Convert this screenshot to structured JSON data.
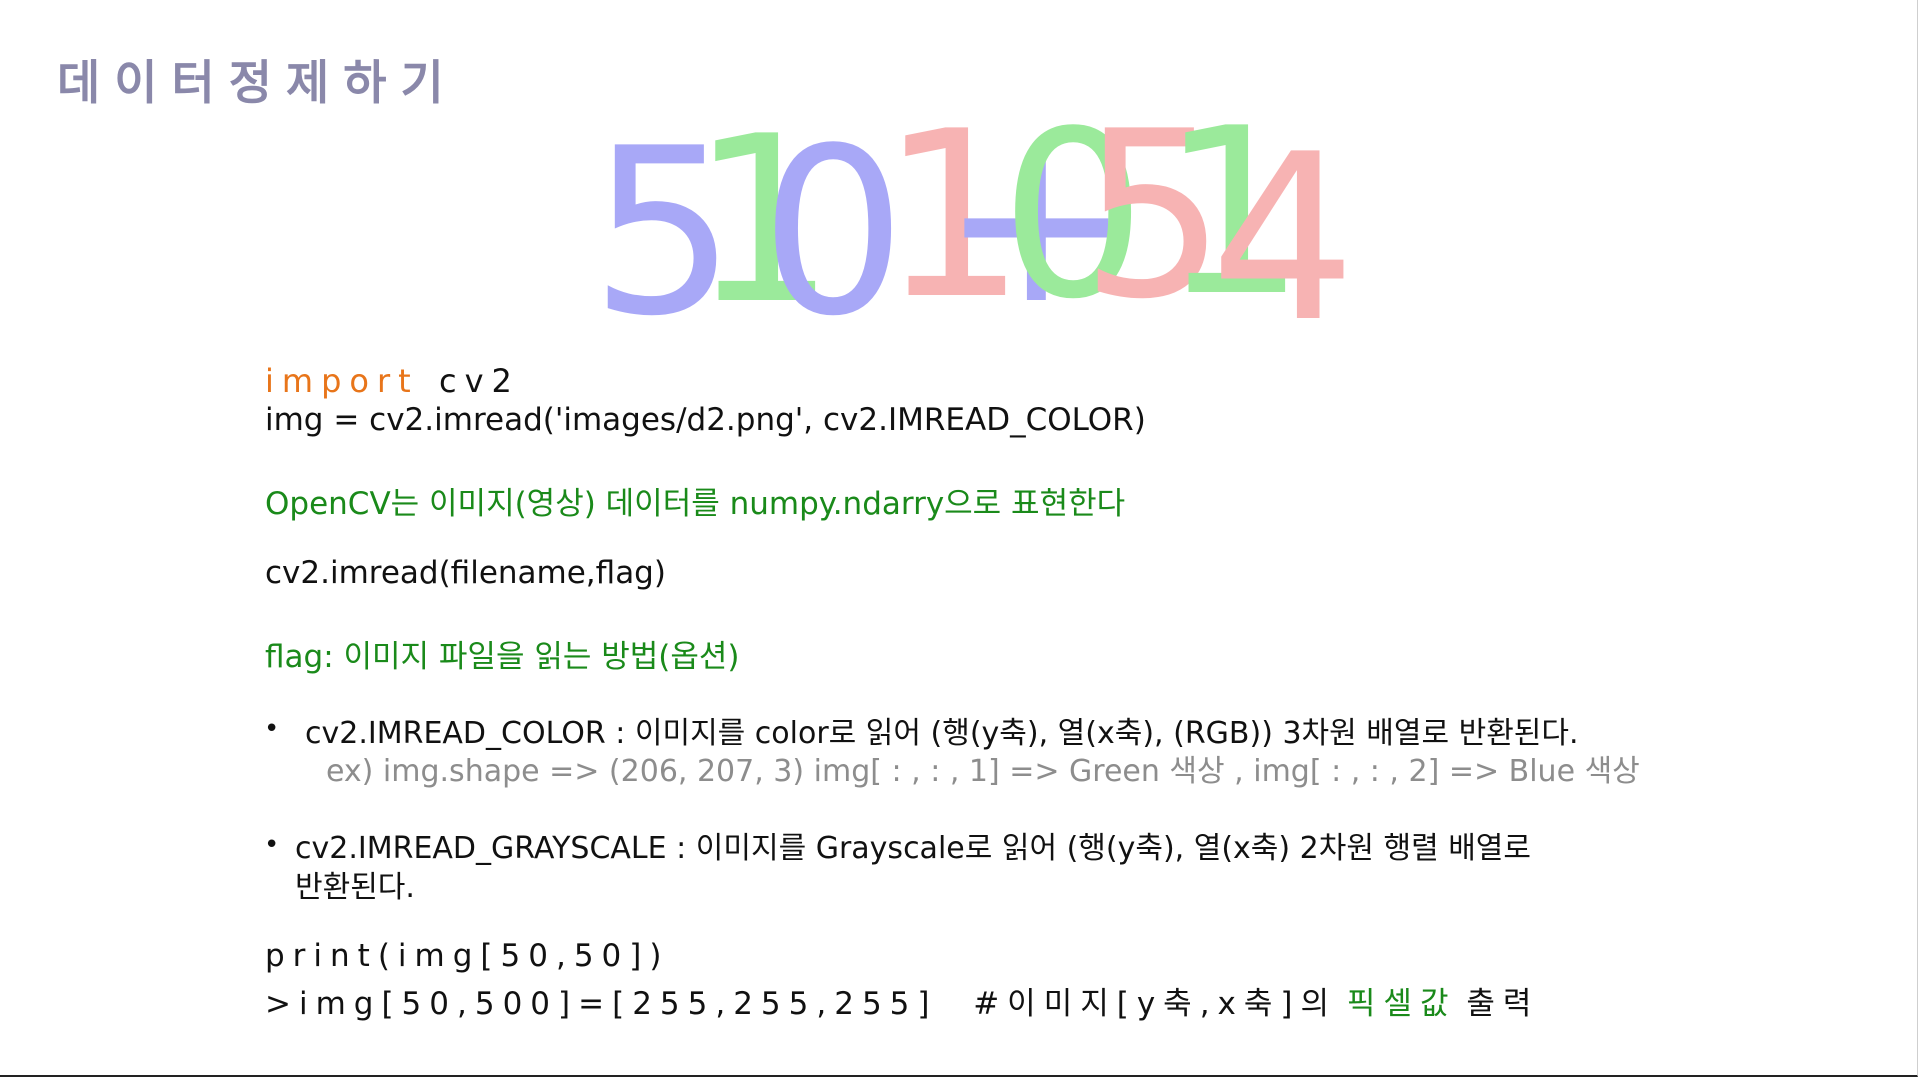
{
  "title": "데이터정제하기",
  "digit_image": {
    "characters": [
      {
        "char": "5",
        "color": "#8c8cf5"
      },
      {
        "char": "1",
        "color": "#7ae37a"
      },
      {
        "char": "0",
        "color": "#8c8cf5"
      },
      {
        "char": "1",
        "color": "#f59a9a"
      },
      {
        "char": "+",
        "color": "#8c8cf5"
      },
      {
        "char": "0",
        "color": "#7ae37a"
      },
      {
        "char": "5",
        "color": "#f59a9a"
      },
      {
        "char": "1",
        "color": "#7ae37a"
      },
      {
        "char": "4",
        "color": "#f59a9a"
      }
    ]
  },
  "code": {
    "import_kw": "import",
    "import_mod": "cv2",
    "imread_line": "img = cv2.imread('images/d2.png', cv2.IMREAD_COLOR)"
  },
  "note_opencv": "OpenCV는 이미지(영상) 데이터를 numpy.ndarry으로 표현한다",
  "imread_sig": "cv2.imread(filename,flag)",
  "flag_note": "flag: 이미지 파일을 읽는 방법(옵션)",
  "bullets": [
    {
      "text": "cv2.IMREAD_COLOR : 이미지를 color로 읽어 (행(y축), 열(x축), (RGB)) 3차원 배열로 반환된다.",
      "example": "ex) img.shape => (206, 207, 3) img[ : , : , 1] => Green 색상 , img[ : , : , 2] => Blue 색상"
    },
    {
      "text_line1": "cv2.IMREAD_GRAYSCALE : 이미지를 Grayscale로 읽어 (행(y축), 열(x축) 2차원 행렬 배열로",
      "text_line2": "반환된다."
    }
  ],
  "print_line": "print(img[50,50])",
  "output": {
    "prefix": ">img[50,500]=[255,255,255]  #이미지[y축,x축]의",
    "highlight": "픽셀값",
    "suffix": "출력"
  }
}
